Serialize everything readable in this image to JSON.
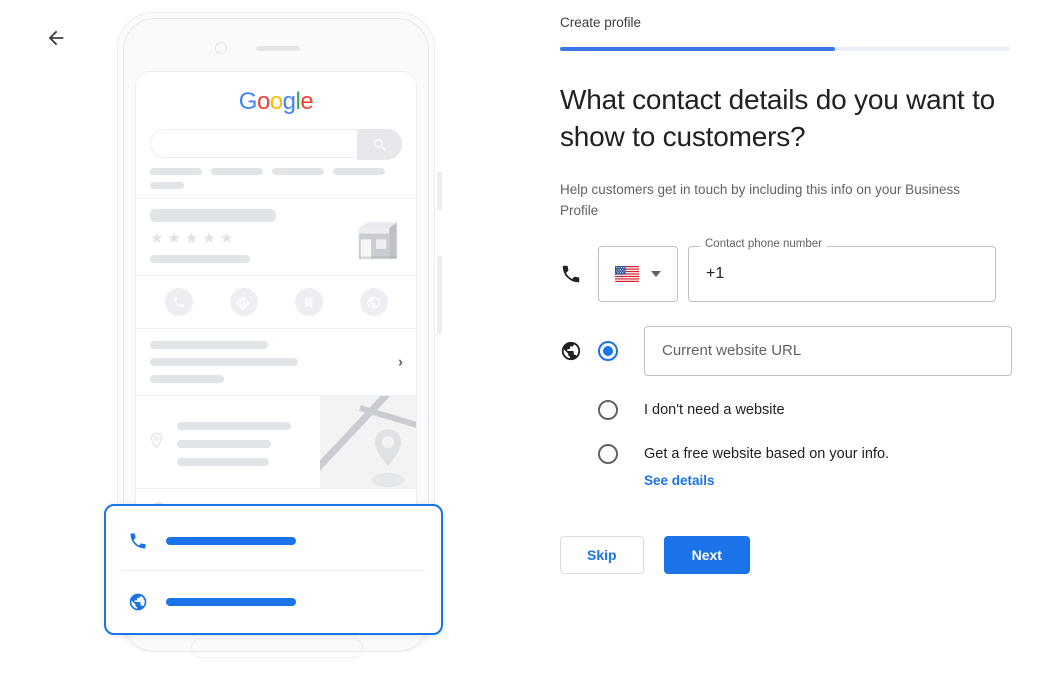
{
  "nav": {
    "back_icon": "arrow-left-icon"
  },
  "breadcrumb": {
    "label": "Create profile"
  },
  "progress": {
    "percent": 61,
    "fill_color": "#3b77e8",
    "track_color": "#e8eefc"
  },
  "heading": {
    "text": "What contact details do you want to show to customers?"
  },
  "subtext": {
    "text": "Help customers get in touch by including this info on your Business Profile"
  },
  "phone_field": {
    "lead_icon": "phone-icon",
    "country_flag": "us-flag-icon",
    "country_caret": "chevron-down-icon",
    "label": "Contact phone number",
    "value": "+1"
  },
  "website": {
    "lead_icon": "globe-icon",
    "options": [
      {
        "id": "current-url",
        "selected": true,
        "placeholder": "Current website URL",
        "type": "input"
      },
      {
        "id": "no-website",
        "selected": false,
        "label": "I don't need a website",
        "type": "label"
      },
      {
        "id": "free-website",
        "selected": false,
        "label": "Get a free website based on your info.",
        "type": "label"
      }
    ],
    "see_details": "See details"
  },
  "actions": {
    "skip": "Skip",
    "next": "Next"
  },
  "illustration": {
    "google_logo": [
      "G",
      "o",
      "o",
      "g",
      "l",
      "e"
    ],
    "search_icon": "search-icon",
    "rating_stars": [
      "★",
      "★",
      "★",
      "★",
      "★"
    ],
    "storefront_icon": "storefront-icon",
    "action_icons": [
      "phone-icon",
      "directions-icon",
      "bookmark-icon",
      "globe-icon"
    ],
    "chevron_icon": "chevron-right-icon",
    "location_icon": "location-pin-icon",
    "map_pin_icon": "map-pin-icon",
    "clock_icon": "clock-icon",
    "callout": {
      "accent_color": "#1a73e8",
      "rows": [
        {
          "icon": "phone-icon"
        },
        {
          "icon": "globe-icon"
        }
      ]
    }
  }
}
